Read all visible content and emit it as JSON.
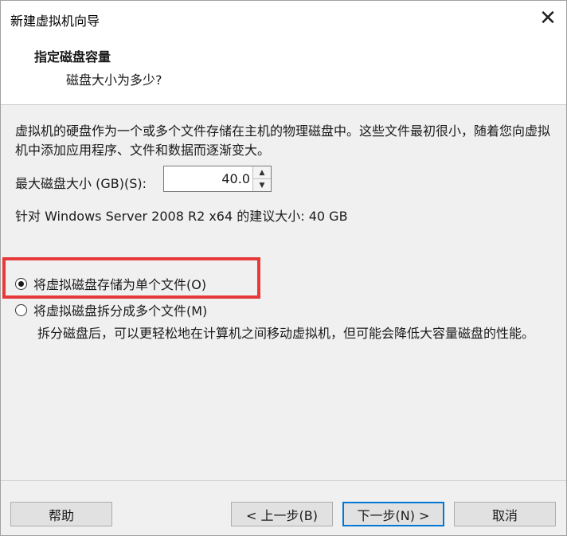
{
  "window": {
    "title": "新建虚拟机向导",
    "close_glyph": "✕"
  },
  "header": {
    "title": "指定磁盘容量",
    "subtitle": "磁盘大小为多少?"
  },
  "body": {
    "description": "虚拟机的硬盘作为一个或多个文件存储在主机的物理磁盘中。这些文件最初很小，随着您向虚拟机中添加应用程序、文件和数据而逐渐变大。",
    "size_label": "最大磁盘大小 (GB)(S):",
    "size_value": "40.0",
    "recommendation": "针对 Windows Server 2008 R2 x64 的建议大小: 40 GB",
    "options": [
      {
        "label": "将虚拟磁盘存储为单个文件(O)",
        "selected": true
      },
      {
        "label": "将虚拟磁盘拆分成多个文件(M)",
        "selected": false
      }
    ],
    "split_note": "拆分磁盘后，可以更轻松地在计算机之间移动虚拟机，但可能会降低大容量磁盘的性能。"
  },
  "footer": {
    "help": "帮助",
    "back": "< 上一步(B)",
    "next": "下一步(N) >",
    "cancel": "取消"
  },
  "colors": {
    "highlight": "#e63a3a",
    "primary_border": "#0078d7"
  }
}
